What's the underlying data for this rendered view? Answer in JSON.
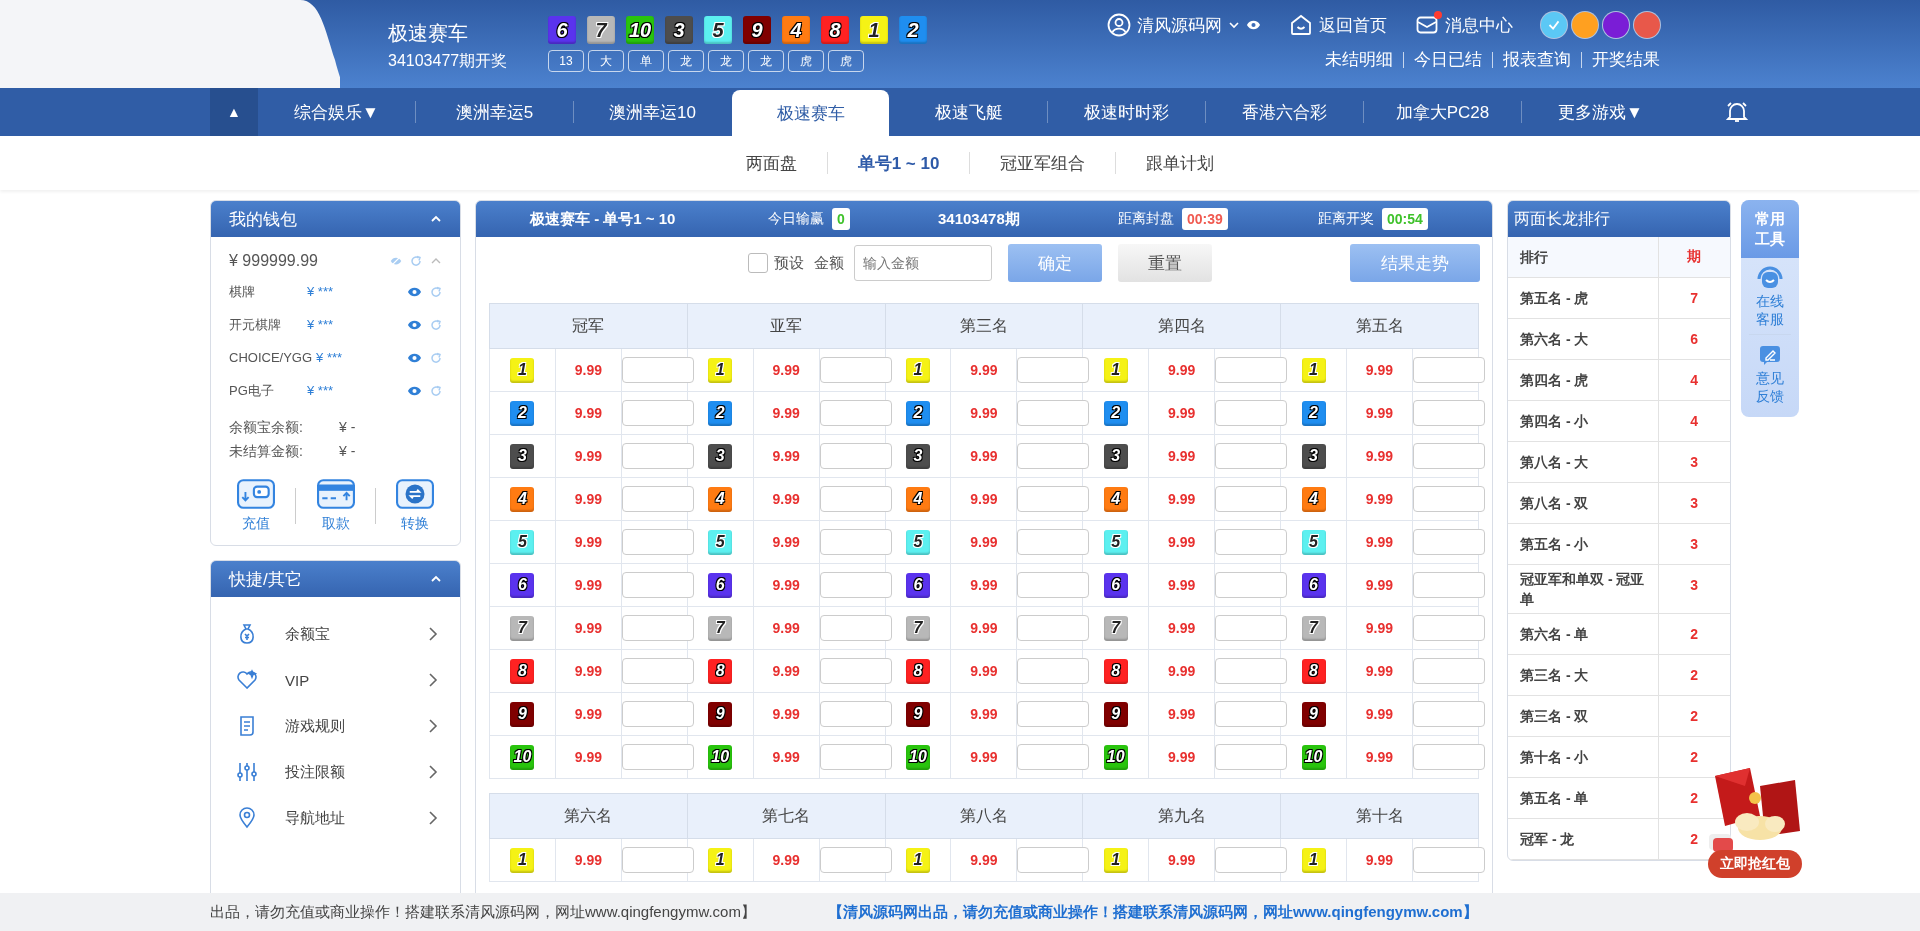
{
  "header": {
    "title": "极速赛车",
    "issue": "34103477期开奖",
    "balls": [
      {
        "num": "6",
        "color": "#5a33ee"
      },
      {
        "num": "7",
        "color": "#b8b8b8"
      },
      {
        "num": "10",
        "color": "#29c40d"
      },
      {
        "num": "3",
        "color": "#4d4d4d"
      },
      {
        "num": "5",
        "color": "#5cf0f0"
      },
      {
        "num": "9",
        "color": "#800000"
      },
      {
        "num": "4",
        "color": "#ff7b12"
      },
      {
        "num": "8",
        "color": "#ff2222"
      },
      {
        "num": "1",
        "color": "#f5f215"
      },
      {
        "num": "2",
        "color": "#1f8ef0"
      }
    ],
    "tags": [
      "13",
      "大",
      "单",
      "龙",
      "龙",
      "龙",
      "虎",
      "虎"
    ],
    "user": "清风源码网",
    "home": "返回首页",
    "messages": {
      "label": "消息中心",
      "unread": true
    },
    "themes": [
      {
        "color": "#5bc8f5",
        "selected": true
      },
      {
        "color": "#ffa020",
        "selected": false
      },
      {
        "color": "#7a1dd6",
        "selected": false
      },
      {
        "color": "#e8584a",
        "selected": false
      }
    ],
    "links": [
      "未结明细",
      "今日已结",
      "报表查询",
      "开奖结果"
    ]
  },
  "nav": {
    "toggle": "▲",
    "items": [
      {
        "label": "综合娱乐▼",
        "selected": false
      },
      {
        "label": "澳洲幸运5",
        "selected": false
      },
      {
        "label": "澳洲幸运10",
        "selected": false
      },
      {
        "label": "极速赛车",
        "selected": true
      },
      {
        "label": "极速飞艇",
        "selected": false
      },
      {
        "label": "极速时时彩",
        "selected": false
      },
      {
        "label": "香港六合彩",
        "selected": false
      },
      {
        "label": "加拿大PC28",
        "selected": false
      },
      {
        "label": "更多游戏▼",
        "selected": false
      }
    ]
  },
  "subnav": [
    {
      "label": "两面盘",
      "selected": false
    },
    {
      "label": "单号1 ~ 10",
      "selected": true
    },
    {
      "label": "冠亚军组合",
      "selected": false
    },
    {
      "label": "跟单计划",
      "selected": false
    }
  ],
  "wallet": {
    "title": "我的钱包",
    "balance": "¥ 999999.99",
    "accounts": [
      {
        "name": "棋牌",
        "amount": "¥ ***"
      },
      {
        "name": "开元棋牌",
        "amount": "¥ ***"
      },
      {
        "name": "CHOICE/YGG",
        "amount": "¥ ***"
      },
      {
        "name": "PG电子",
        "amount": "¥ ***"
      }
    ],
    "summary": [
      {
        "label": "余额宝余额:",
        "value": "¥ -"
      },
      {
        "label": "未结算金额:",
        "value": "¥ -"
      }
    ],
    "actions": [
      "充值",
      "取款",
      "转换"
    ]
  },
  "quick": {
    "title": "快捷/其它",
    "items": [
      "余额宝",
      "VIP",
      "游戏规则",
      "投注限额",
      "导航地址"
    ]
  },
  "game": {
    "title": "极速赛车 - 单号1 ~ 10",
    "winloss_label": "今日输赢",
    "winloss": "0",
    "issue": "34103478期",
    "close_label": "距离封盘",
    "close": "00:39",
    "draw_label": "距离开奖",
    "draw": "00:54",
    "preset": {
      "label": "预设",
      "checked": false
    },
    "amount_label": "金额",
    "amount_placeholder": "输入金额",
    "confirm": "确定",
    "reset": "重置",
    "trend": "结果走势",
    "boards": [
      {
        "columns": [
          {
            "title": "冠军",
            "cells": [
              {
                "ball": "1",
                "color": "#f5f215",
                "odds": "9.99"
              },
              {
                "ball": "2",
                "color": "#1f8ef0",
                "odds": "9.99"
              },
              {
                "ball": "3",
                "color": "#4d4d4d",
                "odds": "9.99"
              },
              {
                "ball": "4",
                "color": "#ff7b12",
                "odds": "9.99"
              },
              {
                "ball": "5",
                "color": "#5cf0f0",
                "odds": "9.99"
              },
              {
                "ball": "6",
                "color": "#5a33ee",
                "odds": "9.99"
              },
              {
                "ball": "7",
                "color": "#b8b8b8",
                "odds": "9.99"
              },
              {
                "ball": "8",
                "color": "#ff2222",
                "odds": "9.99"
              },
              {
                "ball": "9",
                "color": "#800000",
                "odds": "9.99"
              },
              {
                "ball": "10",
                "color": "#29c40d",
                "odds": "9.99"
              }
            ]
          },
          {
            "title": "亚军",
            "cells": [
              {
                "ball": "1",
                "color": "#f5f215",
                "odds": "9.99"
              },
              {
                "ball": "2",
                "color": "#1f8ef0",
                "odds": "9.99"
              },
              {
                "ball": "3",
                "color": "#4d4d4d",
                "odds": "9.99"
              },
              {
                "ball": "4",
                "color": "#ff7b12",
                "odds": "9.99"
              },
              {
                "ball": "5",
                "color": "#5cf0f0",
                "odds": "9.99"
              },
              {
                "ball": "6",
                "color": "#5a33ee",
                "odds": "9.99"
              },
              {
                "ball": "7",
                "color": "#b8b8b8",
                "odds": "9.99"
              },
              {
                "ball": "8",
                "color": "#ff2222",
                "odds": "9.99"
              },
              {
                "ball": "9",
                "color": "#800000",
                "odds": "9.99"
              },
              {
                "ball": "10",
                "color": "#29c40d",
                "odds": "9.99"
              }
            ]
          },
          {
            "title": "第三名",
            "cells": [
              {
                "ball": "1",
                "color": "#f5f215",
                "odds": "9.99"
              },
              {
                "ball": "2",
                "color": "#1f8ef0",
                "odds": "9.99"
              },
              {
                "ball": "3",
                "color": "#4d4d4d",
                "odds": "9.99"
              },
              {
                "ball": "4",
                "color": "#ff7b12",
                "odds": "9.99"
              },
              {
                "ball": "5",
                "color": "#5cf0f0",
                "odds": "9.99"
              },
              {
                "ball": "6",
                "color": "#5a33ee",
                "odds": "9.99"
              },
              {
                "ball": "7",
                "color": "#b8b8b8",
                "odds": "9.99"
              },
              {
                "ball": "8",
                "color": "#ff2222",
                "odds": "9.99"
              },
              {
                "ball": "9",
                "color": "#800000",
                "odds": "9.99"
              },
              {
                "ball": "10",
                "color": "#29c40d",
                "odds": "9.99"
              }
            ]
          },
          {
            "title": "第四名",
            "cells": [
              {
                "ball": "1",
                "color": "#f5f215",
                "odds": "9.99"
              },
              {
                "ball": "2",
                "color": "#1f8ef0",
                "odds": "9.99"
              },
              {
                "ball": "3",
                "color": "#4d4d4d",
                "odds": "9.99"
              },
              {
                "ball": "4",
                "color": "#ff7b12",
                "odds": "9.99"
              },
              {
                "ball": "5",
                "color": "#5cf0f0",
                "odds": "9.99"
              },
              {
                "ball": "6",
                "color": "#5a33ee",
                "odds": "9.99"
              },
              {
                "ball": "7",
                "color": "#b8b8b8",
                "odds": "9.99"
              },
              {
                "ball": "8",
                "color": "#ff2222",
                "odds": "9.99"
              },
              {
                "ball": "9",
                "color": "#800000",
                "odds": "9.99"
              },
              {
                "ball": "10",
                "color": "#29c40d",
                "odds": "9.99"
              }
            ]
          },
          {
            "title": "第五名",
            "cells": [
              {
                "ball": "1",
                "color": "#f5f215",
                "odds": "9.99"
              },
              {
                "ball": "2",
                "color": "#1f8ef0",
                "odds": "9.99"
              },
              {
                "ball": "3",
                "color": "#4d4d4d",
                "odds": "9.99"
              },
              {
                "ball": "4",
                "color": "#ff7b12",
                "odds": "9.99"
              },
              {
                "ball": "5",
                "color": "#5cf0f0",
                "odds": "9.99"
              },
              {
                "ball": "6",
                "color": "#5a33ee",
                "odds": "9.99"
              },
              {
                "ball": "7",
                "color": "#b8b8b8",
                "odds": "9.99"
              },
              {
                "ball": "8",
                "color": "#ff2222",
                "odds": "9.99"
              },
              {
                "ball": "9",
                "color": "#800000",
                "odds": "9.99"
              },
              {
                "ball": "10",
                "color": "#29c40d",
                "odds": "9.99"
              }
            ]
          }
        ]
      },
      {
        "columns": [
          {
            "title": "第六名",
            "cells": [
              {
                "ball": "1",
                "color": "#f5f215",
                "odds": "9.99"
              }
            ]
          },
          {
            "title": "第七名",
            "cells": [
              {
                "ball": "1",
                "color": "#f5f215",
                "odds": "9.99"
              }
            ]
          },
          {
            "title": "第八名",
            "cells": [
              {
                "ball": "1",
                "color": "#f5f215",
                "odds": "9.99"
              }
            ]
          },
          {
            "title": "第九名",
            "cells": [
              {
                "ball": "1",
                "color": "#f5f215",
                "odds": "9.99"
              }
            ]
          },
          {
            "title": "第十名",
            "cells": [
              {
                "ball": "1",
                "color": "#f5f215",
                "odds": "9.99"
              }
            ]
          }
        ]
      }
    ]
  },
  "ranking": {
    "title": "两面长龙排行",
    "col_name": "排行",
    "col_count": "期",
    "rows": [
      {
        "name": "第五名 - 虎",
        "count": "7"
      },
      {
        "name": "第六名 - 大",
        "count": "6"
      },
      {
        "name": "第四名 - 虎",
        "count": "4"
      },
      {
        "name": "第四名 - 小",
        "count": "4"
      },
      {
        "name": "第八名 - 大",
        "count": "3"
      },
      {
        "name": "第八名 - 双",
        "count": "3"
      },
      {
        "name": "第五名 - 小",
        "count": "3"
      },
      {
        "name": "冠亚军和单双 - 冠亚单",
        "count": "3"
      },
      {
        "name": "第六名 - 单",
        "count": "2"
      },
      {
        "name": "第三名 - 大",
        "count": "2"
      },
      {
        "name": "第三名 - 双",
        "count": "2"
      },
      {
        "name": "第十名 - 小",
        "count": "2"
      },
      {
        "name": "第五名 - 单",
        "count": "2"
      },
      {
        "name": "冠军 - 龙",
        "count": "2"
      }
    ]
  },
  "tools": {
    "title": "常用工具",
    "items": [
      "在线客服",
      "意见反馈"
    ]
  },
  "red_packet": "立即抢红包",
  "notice": {
    "left": "出品，请勿充值或商业操作！搭建联系清风源码网，网址www.qingfengymw.com】",
    "right": "【清风源码网出品，请勿充值或商业操作！搭建联系清风源码网，网址www.qingfengymw.com】"
  }
}
